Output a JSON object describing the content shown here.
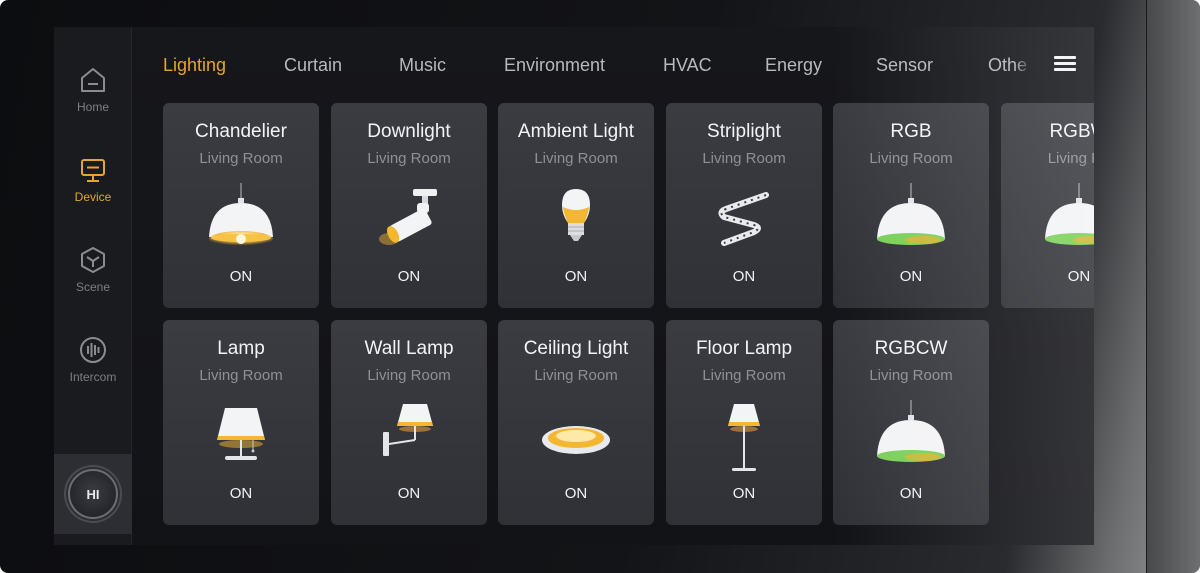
{
  "sidebar": {
    "items": [
      {
        "label": "Home",
        "icon": "home-icon",
        "active": false
      },
      {
        "label": "Device",
        "icon": "monitor-icon",
        "active": true
      },
      {
        "label": "Scene",
        "icon": "cube-icon",
        "active": false
      },
      {
        "label": "Intercom",
        "icon": "intercom-icon",
        "active": false
      }
    ],
    "hi_button": "HI"
  },
  "tabs": [
    "Lighting",
    "Curtain",
    "Music",
    "Environment",
    "HVAC",
    "Energy",
    "Sensor",
    "Othe"
  ],
  "active_tab": "Lighting",
  "menu_icon": "hamburger-menu-icon",
  "devices": [
    {
      "name": "Chandelier",
      "room": "Living Room",
      "state": "ON",
      "icon": "pendant-lamp-icon"
    },
    {
      "name": "Downlight",
      "room": "Living Room",
      "state": "ON",
      "icon": "spotlight-icon"
    },
    {
      "name": "Ambient Light",
      "room": "Living Room",
      "state": "ON",
      "icon": "bulb-icon"
    },
    {
      "name": "Striplight",
      "room": "Living Room",
      "state": "ON",
      "icon": "led-strip-icon"
    },
    {
      "name": "RGB",
      "room": "Living Room",
      "state": "ON",
      "icon": "rgb-pendant-icon"
    },
    {
      "name": "RGBW",
      "room": "Living Ro",
      "state": "ON",
      "icon": "rgbw-pendant-icon"
    },
    {
      "name": "Lamp",
      "room": "Living Room",
      "state": "ON",
      "icon": "table-lamp-icon"
    },
    {
      "name": "Wall Lamp",
      "room": "Living Room",
      "state": "ON",
      "icon": "wall-lamp-icon"
    },
    {
      "name": "Ceiling Light",
      "room": "Living Room",
      "state": "ON",
      "icon": "ceiling-light-icon"
    },
    {
      "name": "Floor Lamp",
      "room": "Living Room",
      "state": "ON",
      "icon": "floor-lamp-icon"
    },
    {
      "name": "RGBCW",
      "room": "Living Room",
      "state": "ON",
      "icon": "rgbcw-pendant-icon"
    }
  ],
  "colors": {
    "accent": "#e8a52b",
    "card_bg": "#36383d",
    "text_primary": "#f2f3f5",
    "text_secondary": "#8e9096"
  }
}
